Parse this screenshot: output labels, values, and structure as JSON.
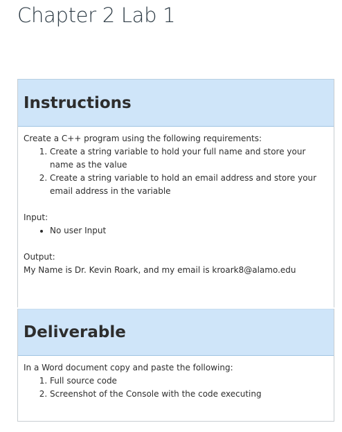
{
  "page": {
    "title": "Chapter 2 Lab 1"
  },
  "instructions": {
    "heading": "Instructions",
    "intro": "Create a C++ program using the following requirements:",
    "steps": [
      "Create a string variable to hold your full name and store your name as the value",
      "Create a string variable to hold an email address and store your email address in the variable"
    ],
    "input_label": "Input:",
    "input_items": [
      "No user Input"
    ],
    "output_label": "Output:",
    "output_text": "My Name is Dr. Kevin Roark, and my email is kroark8@alamo.edu"
  },
  "deliverable": {
    "heading": "Deliverable",
    "intro": "In a Word document copy and paste the following:",
    "items": [
      "Full source code",
      "Screenshot of the Console with the code executing"
    ]
  },
  "colors": {
    "header_background": "#cfe5f9",
    "border": "#c7cdd1",
    "text": "#2d2d2d"
  }
}
